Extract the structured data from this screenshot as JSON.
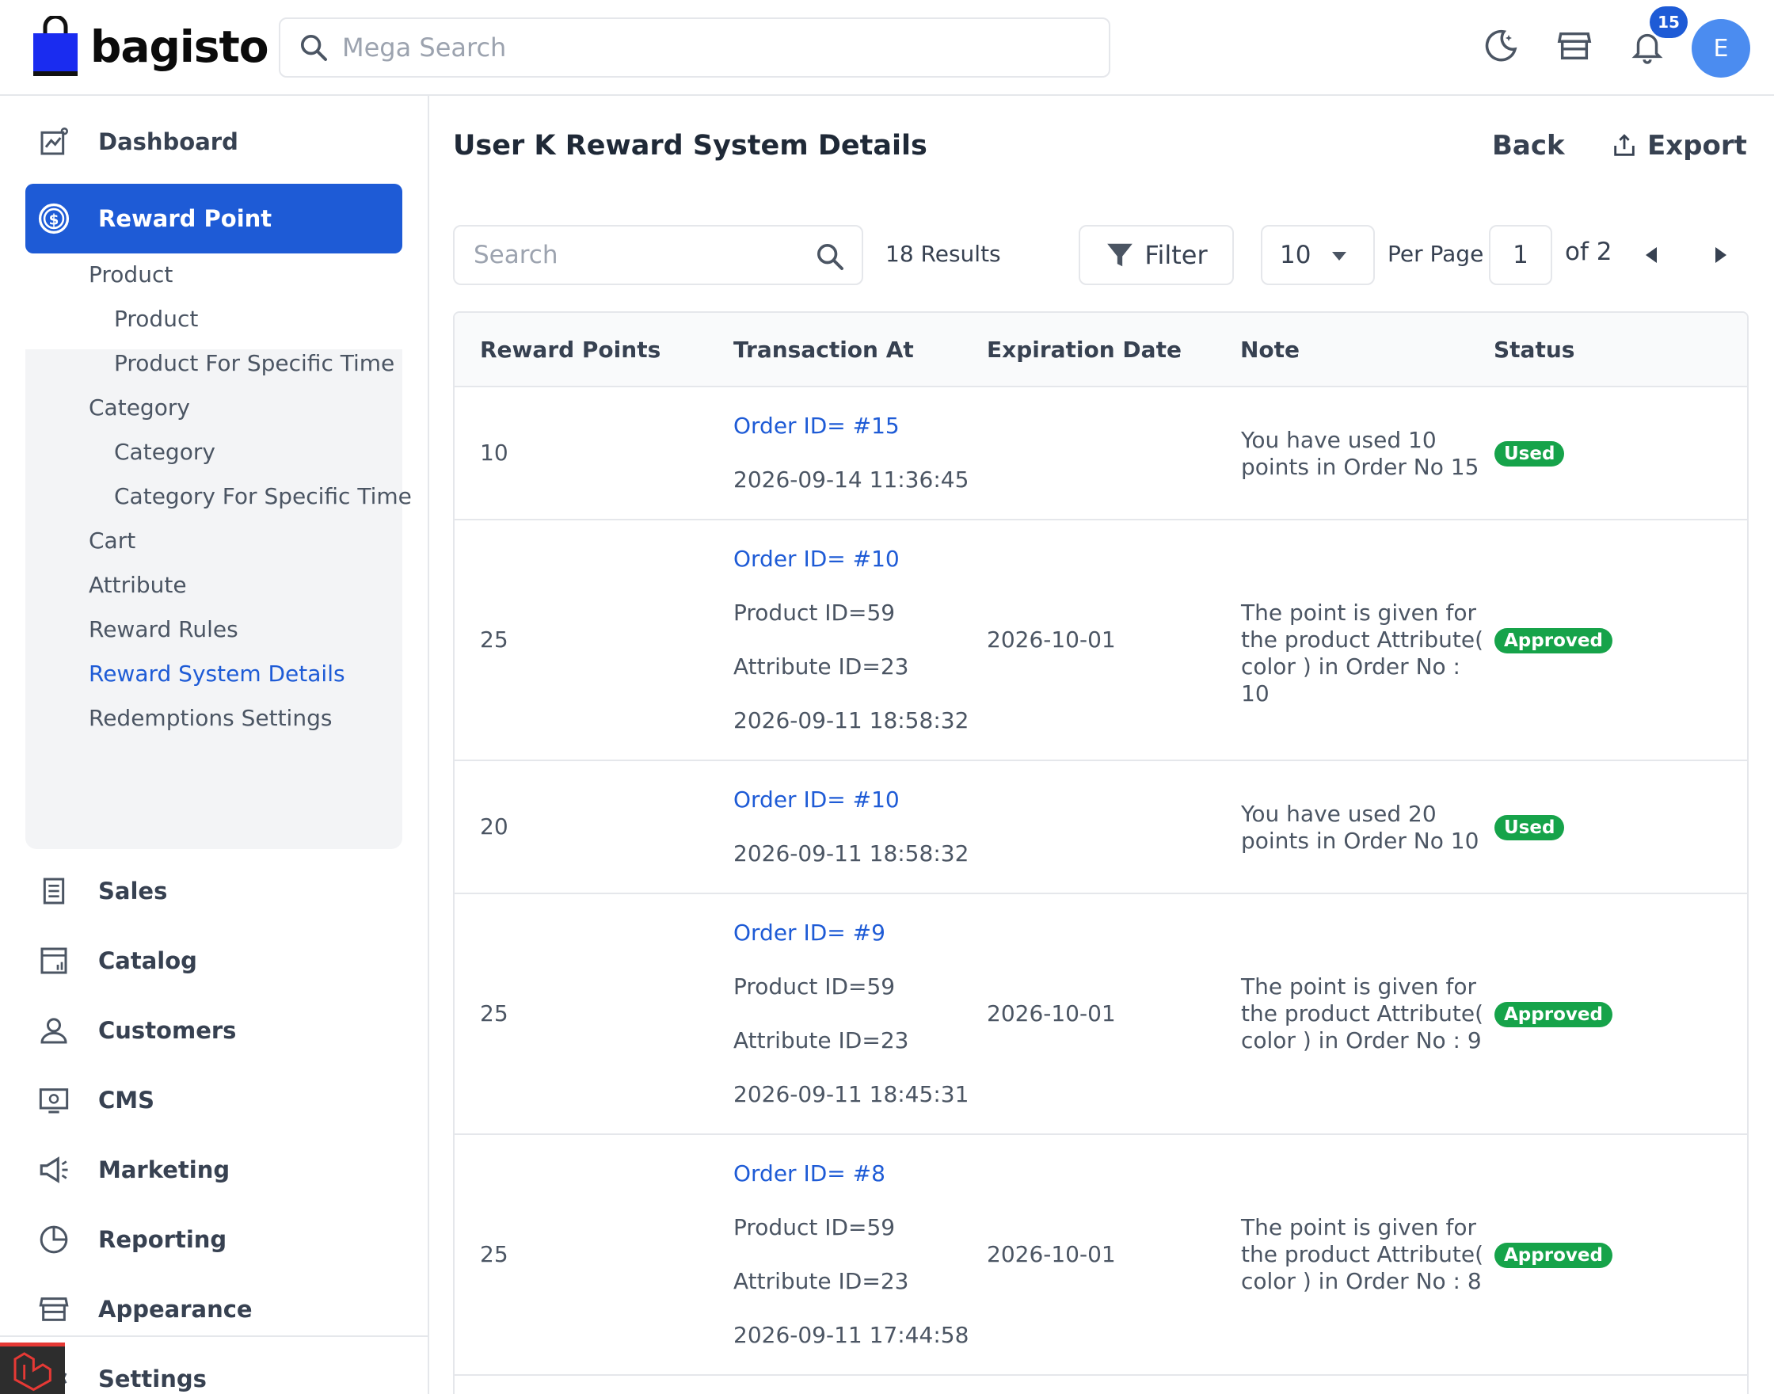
{
  "header": {
    "logo_text": "bagisto",
    "search_placeholder": "Mega Search",
    "notification_count": "15",
    "avatar_initial": "E"
  },
  "sidebar": {
    "dashboard": "Dashboard",
    "reward_point": "Reward Point",
    "sub": {
      "product": "Product",
      "product_child": "Product",
      "product_specific_time": "Product For Specific Time",
      "category": "Category",
      "category_child": "Category",
      "category_specific_time": "Category For Specific Time",
      "cart": "Cart",
      "attribute": "Attribute",
      "reward_rules": "Reward Rules",
      "reward_system_details": "Reward System Details",
      "redemptions_settings": "Redemptions Settings"
    },
    "sales": "Sales",
    "catalog": "Catalog",
    "customers": "Customers",
    "cms": "CMS",
    "marketing": "Marketing",
    "reporting": "Reporting",
    "appearance": "Appearance",
    "settings": "Settings"
  },
  "page": {
    "title": "User K Reward System Details",
    "back": "Back",
    "export": "Export"
  },
  "toolbar": {
    "search_placeholder": "Search",
    "results": "18 Results",
    "filter": "Filter",
    "per_page_value": "10",
    "per_page_label": "Per Page",
    "current_page": "1",
    "of_total": "of 2"
  },
  "table": {
    "headers": {
      "reward_points": "Reward Points",
      "transaction_at": "Transaction At",
      "expiration_date": "Expiration Date",
      "note": "Note",
      "status": "Status"
    },
    "rows": [
      {
        "points": "10",
        "order": "Order ID= #15",
        "date": "2026-09-14 11:36:45",
        "expiration": "",
        "note": "You have used 10 points in Order No 15",
        "status": "Used"
      },
      {
        "points": "25",
        "order": "Order ID= #10",
        "product": "Product ID=59",
        "attribute": "Attribute ID=23",
        "date": "2026-09-11 18:58:32",
        "expiration": "2026-10-01",
        "note": "The point is given for the product Attribute( color ) in Order No : 10",
        "status": "Approved"
      },
      {
        "points": "20",
        "order": "Order ID= #10",
        "date": "2026-09-11 18:58:32",
        "expiration": "",
        "note": "You have used 20 points in Order No 10",
        "status": "Used"
      },
      {
        "points": "25",
        "order": "Order ID= #9",
        "product": "Product ID=59",
        "attribute": "Attribute ID=23",
        "date": "2026-09-11 18:45:31",
        "expiration": "2026-10-01",
        "note": "The point is given for the product Attribute( color ) in Order No : 9",
        "status": "Approved"
      },
      {
        "points": "25",
        "order": "Order ID= #8",
        "product": "Product ID=59",
        "attribute": "Attribute ID=23",
        "date": "2026-09-11 17:44:58",
        "expiration": "2026-10-01",
        "note": "The point is given for the product Attribute( color ) in Order No : 8",
        "status": "Approved"
      }
    ]
  },
  "colors": {
    "accent": "#1e5bd6",
    "success": "#16a34a",
    "avatar": "#4b8cf0"
  },
  "icons": [
    "search-icon",
    "moon-icon",
    "store-icon",
    "bell-icon",
    "dashboard-icon",
    "reward-icon",
    "sales-icon",
    "catalog-icon",
    "customers-icon",
    "cms-icon",
    "marketing-icon",
    "reporting-icon",
    "appearance-icon",
    "settings-icon",
    "export-icon",
    "filter-icon"
  ]
}
